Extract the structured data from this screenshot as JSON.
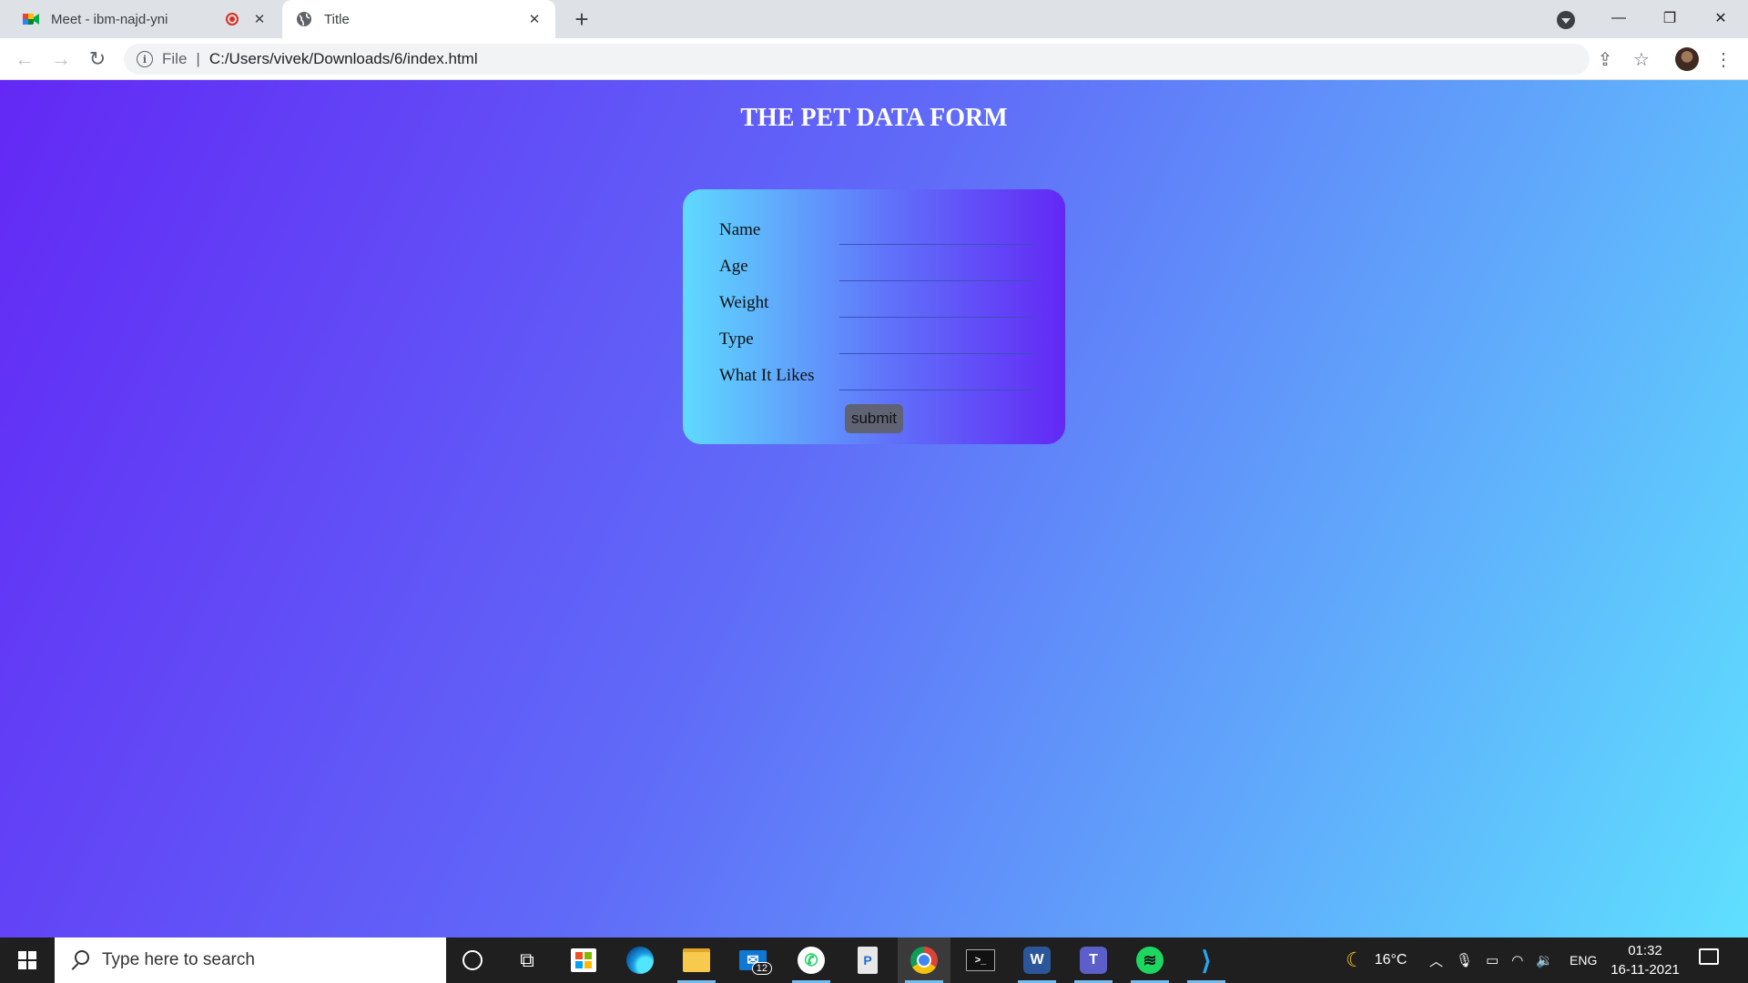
{
  "browser": {
    "tabs": [
      {
        "title": "Meet - ibm-najd-yni",
        "icon": "google-meet-icon",
        "recording": true
      },
      {
        "title": "Title",
        "icon": "globe-icon",
        "active": true
      }
    ],
    "url_scheme": "File",
    "url": "C:/Users/vivek/Downloads/6/index.html"
  },
  "page": {
    "title": "THE PET DATA FORM",
    "gradient_colors": [
      "#6328f5",
      "#606bf8",
      "#5fe0fe"
    ],
    "form": {
      "fields": [
        {
          "label": "Name",
          "value": ""
        },
        {
          "label": "Age",
          "value": ""
        },
        {
          "label": "Weight",
          "value": ""
        },
        {
          "label": "Type",
          "value": ""
        },
        {
          "label": "What It Likes",
          "value": ""
        }
      ],
      "submit_label": "submit"
    }
  },
  "taskbar": {
    "search_placeholder": "Type here to search",
    "mail_badge": "12",
    "weather": "16°C",
    "language": "ENG",
    "time": "01:32",
    "date": "16-11-2021"
  }
}
